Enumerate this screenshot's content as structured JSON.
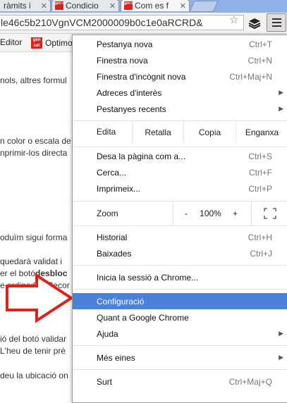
{
  "tabs": [
    {
      "title": "ràmits i",
      "active": false,
      "icon": "page-icon"
    },
    {
      "title": "Condicio",
      "active": false,
      "icon": "gencat-icon"
    },
    {
      "title": "Com es f",
      "active": true,
      "icon": "gencat-icon"
    }
  ],
  "favicon_text": "gen cat",
  "toolbar": {
    "url": "le46c5b210VgnVCM2000009b0c1e0aRCRD&"
  },
  "bookmarks": [
    {
      "label": "Editor"
    },
    {
      "label": "Optimo",
      "icon": "gencat-icon"
    }
  ],
  "page": {
    "lines": [
      "nols, altres formul",
      "n color o escala de",
      "nprimir-los directa",
      "oduïm sigui forma",
      "quedarà validat i",
      "er el botó",
      "desbloc",
      "e ordinador. Recor",
      "ió del botó validar",
      "L'heu de tenir prè",
      "deu la ubicació on"
    ]
  },
  "menu": {
    "new_tab": {
      "label": "Pestanya nova",
      "shortcut": "Ctrl+T"
    },
    "new_window": {
      "label": "Finestra nova",
      "shortcut": "Ctrl+N"
    },
    "incognito": {
      "label": "Finestra d'incògnit nova",
      "shortcut": "Ctrl+Maj+N"
    },
    "bookmarks": {
      "label": "Adreces d'interès"
    },
    "recent_tabs": {
      "label": "Pestanyes recents"
    },
    "edit": {
      "label": "Edita",
      "cut": "Retalla",
      "copy": "Copia",
      "paste": "Enganxa"
    },
    "save_page": {
      "label": "Desa la pàgina com a...",
      "shortcut": "Ctrl+S"
    },
    "find": {
      "label": "Cerca...",
      "shortcut": "Ctrl+F"
    },
    "print": {
      "label": "Imprimeix...",
      "shortcut": "Ctrl+P"
    },
    "zoom": {
      "label": "Zoom",
      "minus": "-",
      "level": "100%",
      "plus": "+"
    },
    "history": {
      "label": "Historial",
      "shortcut": "Ctrl+H"
    },
    "downloads": {
      "label": "Baixades",
      "shortcut": "Ctrl+J"
    },
    "signin": {
      "label": "Inicia la sessió a Chrome..."
    },
    "settings": {
      "label": "Configuració",
      "highlighted": true
    },
    "about": {
      "label": "Quant a Google Chrome"
    },
    "help": {
      "label": "Ajuda"
    },
    "more_tools": {
      "label": "Més eines"
    },
    "exit": {
      "label": "Surt",
      "shortcut": "Ctrl+Maj+Q"
    }
  },
  "colors": {
    "highlight": "#4a82d9",
    "arrow": "#e0201b",
    "tabstrip": "#8fb0e8"
  }
}
